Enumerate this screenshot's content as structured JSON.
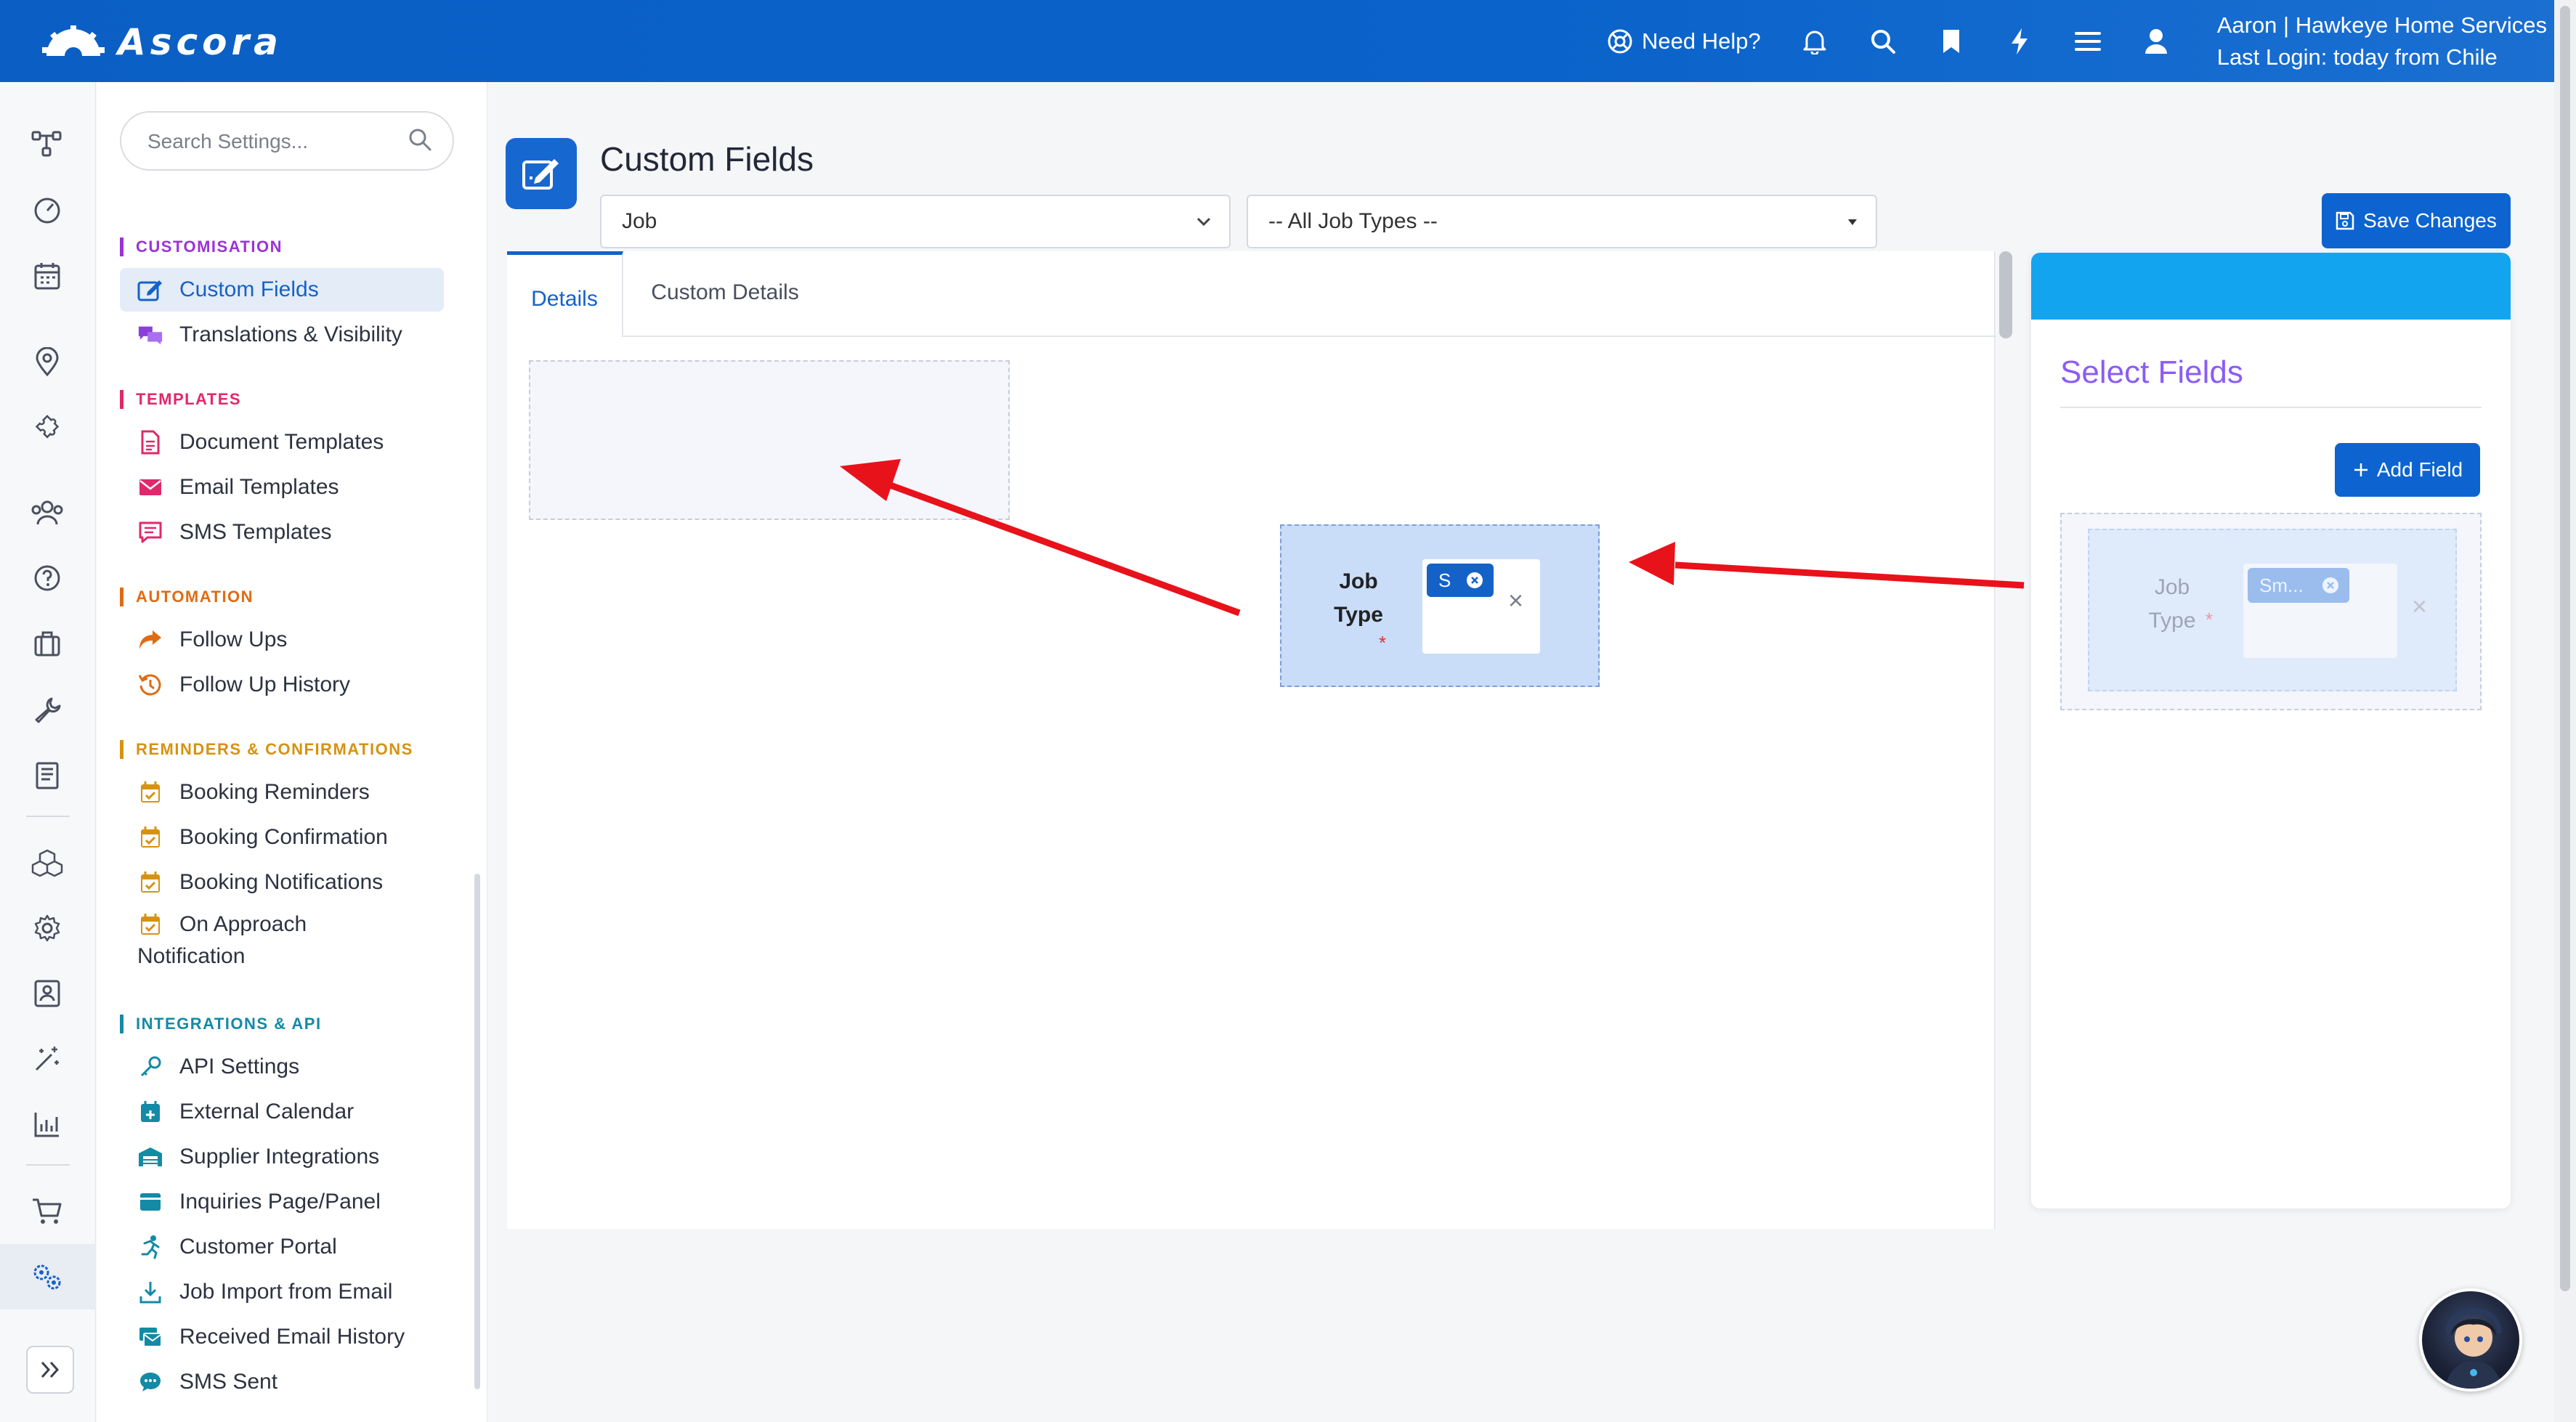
{
  "app": {
    "logo_text": "Ascora"
  },
  "topbar": {
    "help_label": "Need Help?",
    "user_name": "Aaron | Hawkeye Home Services",
    "last_login": "Last Login: today from Chile"
  },
  "search": {
    "placeholder": "Search Settings..."
  },
  "sidebar": {
    "sections": [
      {
        "title": "CUSTOMISATION",
        "items": [
          {
            "label": "Custom Fields",
            "icon": "edit-square-icon",
            "active": true
          },
          {
            "label": "Translations & Visibility",
            "icon": "chat-bubbles-icon"
          }
        ]
      },
      {
        "title": "TEMPLATES",
        "items": [
          {
            "label": "Document Templates",
            "icon": "document-icon"
          },
          {
            "label": "Email Templates",
            "icon": "envelope-icon"
          },
          {
            "label": "SMS Templates",
            "icon": "message-icon"
          }
        ]
      },
      {
        "title": "AUTOMATION",
        "items": [
          {
            "label": "Follow Ups",
            "icon": "share-arrow-icon"
          },
          {
            "label": "Follow Up History",
            "icon": "history-icon"
          }
        ]
      },
      {
        "title": "REMINDERS & CONFIRMATIONS",
        "items": [
          {
            "label": "Booking Reminders",
            "icon": "calendar-check-icon"
          },
          {
            "label": "Booking Confirmation",
            "icon": "calendar-check-icon"
          },
          {
            "label": "Booking Notifications",
            "icon": "calendar-check-icon"
          },
          {
            "label": "On Approach Notification",
            "icon": "calendar-check-icon"
          }
        ]
      },
      {
        "title": "INTEGRATIONS & API",
        "items": [
          {
            "label": "API Settings",
            "icon": "key-icon"
          },
          {
            "label": "External Calendar",
            "icon": "calendar-plus-icon"
          },
          {
            "label": "Supplier Integrations",
            "icon": "warehouse-icon"
          },
          {
            "label": "Inquiries Page/Panel",
            "icon": "panel-icon"
          },
          {
            "label": "Customer Portal",
            "icon": "running-person-icon"
          },
          {
            "label": "Job Import from Email",
            "icon": "download-icon"
          },
          {
            "label": "Received Email History",
            "icon": "mail-stack-icon"
          },
          {
            "label": "SMS Sent",
            "icon": "sms-bubble-icon"
          }
        ]
      }
    ]
  },
  "page": {
    "title": "Custom Fields",
    "entity_select": "Job",
    "job_type_select": "-- All Job Types --",
    "save_label": "Save Changes",
    "tabs": [
      "Details",
      "Custom Details"
    ]
  },
  "dragged_field": {
    "label_line1": "Job",
    "label_line2": "Type",
    "required_mark": "*",
    "chip_text": "S",
    "remove_glyph": "×"
  },
  "select_panel": {
    "title": "Select Fields",
    "add_label": "Add Field",
    "ghost_field": {
      "label_line1": "Job",
      "label_line2": "Type",
      "required_mark": "*",
      "chip_text": "Sm...",
      "remove_glyph": "×"
    }
  },
  "colors": {
    "brand": "#0b5fc4",
    "accent": "#1462c8",
    "panel_header": "#13a4f0",
    "arrow": "#e8121b"
  }
}
